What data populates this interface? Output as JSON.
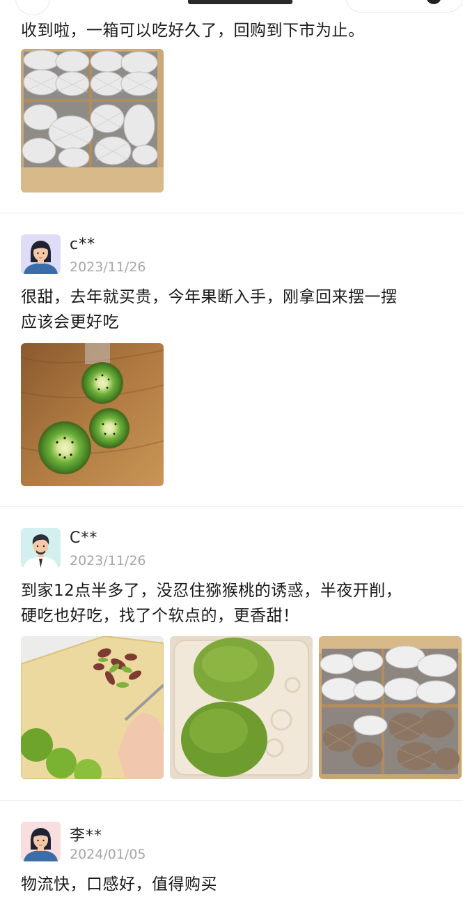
{
  "reviews": [
    {
      "text": "收到啦，一箱可以吃好久了，回购到下市为止。",
      "photos": [
        "kiwi-box-foam-nets"
      ]
    },
    {
      "user": "c**",
      "date": "2023/11/26",
      "avatar": "female-avatar-icon",
      "text_lines": [
        "很甜，去年就买贵，今年果断入手，刚拿回来摆一摆",
        "应该会更好吃"
      ],
      "photos": [
        "kiwi-halves-on-table"
      ]
    },
    {
      "user": "C**",
      "date": "2023/11/26",
      "avatar": "male-avatar-icon",
      "text_lines": [
        "到家12点半多了，没忍住猕猴桃的诱惑，半夜开削，",
        "硬吃也好吃，找了个软点的，更香甜！"
      ],
      "photos": [
        "peeling-kiwi",
        "peeled-kiwis-on-tray",
        "kiwi-box-open"
      ]
    },
    {
      "user": "李**",
      "date": "2024/01/05",
      "avatar": "female-avatar-icon",
      "text": "物流快，口感好，值得购买"
    }
  ],
  "colors": {
    "date": "#a6a6a6",
    "divider": "#ececec",
    "kiwi_green": "#5f9e2c"
  }
}
